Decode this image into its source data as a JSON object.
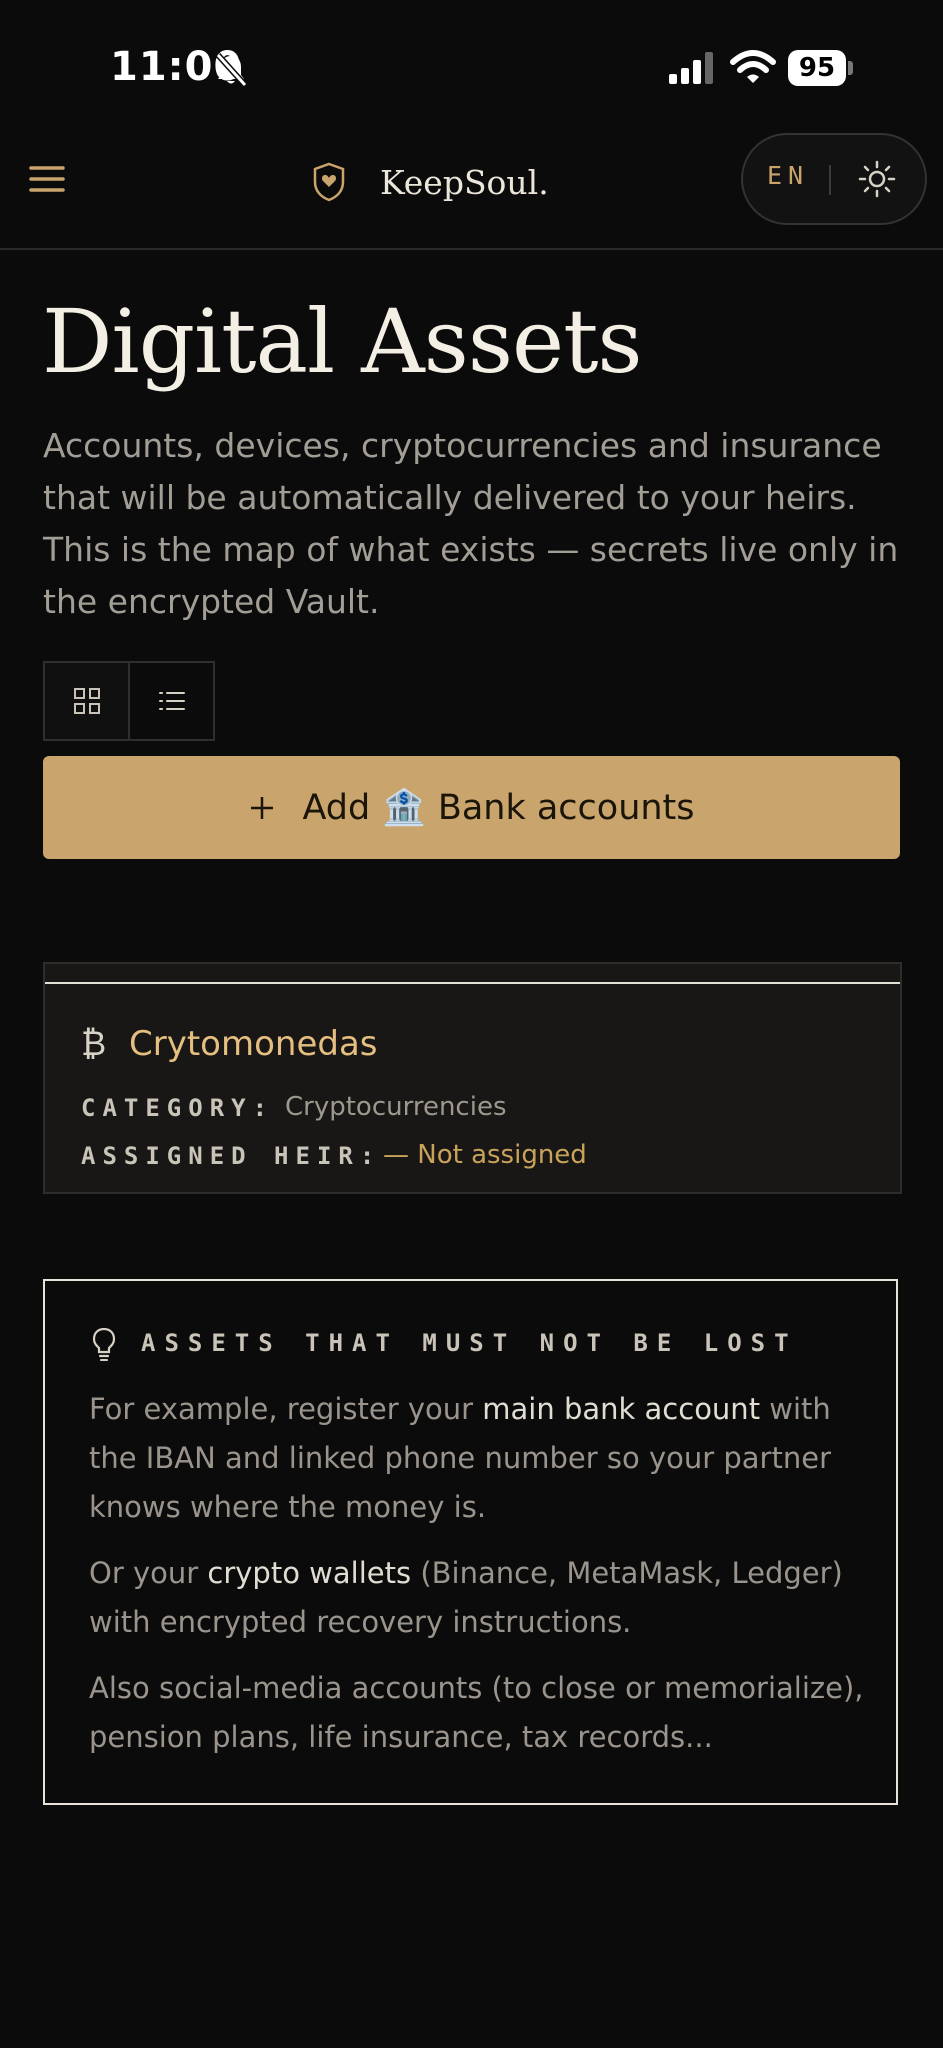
{
  "status_bar": {
    "time": "11:00",
    "battery": "95"
  },
  "header": {
    "brand": "KeepSoul.",
    "language": "EN"
  },
  "page": {
    "title": "Digital Assets",
    "description": "Accounts, devices, cryptocurrencies and insurance that will be automatically delivered to your heirs. This is the map of what exists — secrets live only in the encrypted Vault."
  },
  "add_button": {
    "prefix": "Add",
    "emoji": "🏦",
    "label": "Bank accounts"
  },
  "asset": {
    "symbol": "₿",
    "name": "Crytomonedas",
    "category_label": "CATEGORY:",
    "category_value": "Cryptocurrencies",
    "heir_label": "ASSIGNED HEIR:",
    "heir_value": "— Not assigned"
  },
  "tip": {
    "title": "ASSETS THAT MUST NOT BE LOST",
    "p1_a": "For example, register your ",
    "p1_b": "main bank account",
    "p1_c": " with the IBAN and linked phone number so your partner knows where the money is.",
    "p2_a": "Or your ",
    "p2_b": "crypto wallets",
    "p2_c": " (Binance, MetaMask, Ledger) with encrypted recovery instructions.",
    "p3": "Also social-media accounts (to close or memorialize), pension plans, life insurance, tax records..."
  },
  "colors": {
    "accent": "#c9a46d",
    "background": "#0b0b0b",
    "card": "#181716",
    "heir_status": "#c9a35a"
  }
}
